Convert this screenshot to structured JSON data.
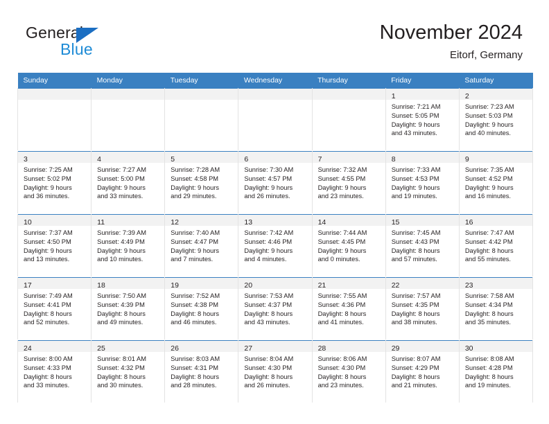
{
  "brand": {
    "name_dark": "General",
    "name_light": "Blue",
    "triangle_color": "#1b6ec2",
    "light_color": "#1e8bd6"
  },
  "header": {
    "title": "November 2024",
    "subtitle": "Eitorf, Germany",
    "header_bg": "#3a80c1",
    "daynum_bg": "#f2f2f2"
  },
  "weekdays": [
    "Sunday",
    "Monday",
    "Tuesday",
    "Wednesday",
    "Thursday",
    "Friday",
    "Saturday"
  ],
  "weeks": [
    [
      {
        "day": "",
        "lines": []
      },
      {
        "day": "",
        "lines": []
      },
      {
        "day": "",
        "lines": []
      },
      {
        "day": "",
        "lines": []
      },
      {
        "day": "",
        "lines": []
      },
      {
        "day": "1",
        "lines": [
          "Sunrise: 7:21 AM",
          "Sunset: 5:05 PM",
          "Daylight: 9 hours",
          "and 43 minutes."
        ]
      },
      {
        "day": "2",
        "lines": [
          "Sunrise: 7:23 AM",
          "Sunset: 5:03 PM",
          "Daylight: 9 hours",
          "and 40 minutes."
        ]
      }
    ],
    [
      {
        "day": "3",
        "lines": [
          "Sunrise: 7:25 AM",
          "Sunset: 5:02 PM",
          "Daylight: 9 hours",
          "and 36 minutes."
        ]
      },
      {
        "day": "4",
        "lines": [
          "Sunrise: 7:27 AM",
          "Sunset: 5:00 PM",
          "Daylight: 9 hours",
          "and 33 minutes."
        ]
      },
      {
        "day": "5",
        "lines": [
          "Sunrise: 7:28 AM",
          "Sunset: 4:58 PM",
          "Daylight: 9 hours",
          "and 29 minutes."
        ]
      },
      {
        "day": "6",
        "lines": [
          "Sunrise: 7:30 AM",
          "Sunset: 4:57 PM",
          "Daylight: 9 hours",
          "and 26 minutes."
        ]
      },
      {
        "day": "7",
        "lines": [
          "Sunrise: 7:32 AM",
          "Sunset: 4:55 PM",
          "Daylight: 9 hours",
          "and 23 minutes."
        ]
      },
      {
        "day": "8",
        "lines": [
          "Sunrise: 7:33 AM",
          "Sunset: 4:53 PM",
          "Daylight: 9 hours",
          "and 19 minutes."
        ]
      },
      {
        "day": "9",
        "lines": [
          "Sunrise: 7:35 AM",
          "Sunset: 4:52 PM",
          "Daylight: 9 hours",
          "and 16 minutes."
        ]
      }
    ],
    [
      {
        "day": "10",
        "lines": [
          "Sunrise: 7:37 AM",
          "Sunset: 4:50 PM",
          "Daylight: 9 hours",
          "and 13 minutes."
        ]
      },
      {
        "day": "11",
        "lines": [
          "Sunrise: 7:39 AM",
          "Sunset: 4:49 PM",
          "Daylight: 9 hours",
          "and 10 minutes."
        ]
      },
      {
        "day": "12",
        "lines": [
          "Sunrise: 7:40 AM",
          "Sunset: 4:47 PM",
          "Daylight: 9 hours",
          "and 7 minutes."
        ]
      },
      {
        "day": "13",
        "lines": [
          "Sunrise: 7:42 AM",
          "Sunset: 4:46 PM",
          "Daylight: 9 hours",
          "and 4 minutes."
        ]
      },
      {
        "day": "14",
        "lines": [
          "Sunrise: 7:44 AM",
          "Sunset: 4:45 PM",
          "Daylight: 9 hours",
          "and 0 minutes."
        ]
      },
      {
        "day": "15",
        "lines": [
          "Sunrise: 7:45 AM",
          "Sunset: 4:43 PM",
          "Daylight: 8 hours",
          "and 57 minutes."
        ]
      },
      {
        "day": "16",
        "lines": [
          "Sunrise: 7:47 AM",
          "Sunset: 4:42 PM",
          "Daylight: 8 hours",
          "and 55 minutes."
        ]
      }
    ],
    [
      {
        "day": "17",
        "lines": [
          "Sunrise: 7:49 AM",
          "Sunset: 4:41 PM",
          "Daylight: 8 hours",
          "and 52 minutes."
        ]
      },
      {
        "day": "18",
        "lines": [
          "Sunrise: 7:50 AM",
          "Sunset: 4:39 PM",
          "Daylight: 8 hours",
          "and 49 minutes."
        ]
      },
      {
        "day": "19",
        "lines": [
          "Sunrise: 7:52 AM",
          "Sunset: 4:38 PM",
          "Daylight: 8 hours",
          "and 46 minutes."
        ]
      },
      {
        "day": "20",
        "lines": [
          "Sunrise: 7:53 AM",
          "Sunset: 4:37 PM",
          "Daylight: 8 hours",
          "and 43 minutes."
        ]
      },
      {
        "day": "21",
        "lines": [
          "Sunrise: 7:55 AM",
          "Sunset: 4:36 PM",
          "Daylight: 8 hours",
          "and 41 minutes."
        ]
      },
      {
        "day": "22",
        "lines": [
          "Sunrise: 7:57 AM",
          "Sunset: 4:35 PM",
          "Daylight: 8 hours",
          "and 38 minutes."
        ]
      },
      {
        "day": "23",
        "lines": [
          "Sunrise: 7:58 AM",
          "Sunset: 4:34 PM",
          "Daylight: 8 hours",
          "and 35 minutes."
        ]
      }
    ],
    [
      {
        "day": "24",
        "lines": [
          "Sunrise: 8:00 AM",
          "Sunset: 4:33 PM",
          "Daylight: 8 hours",
          "and 33 minutes."
        ]
      },
      {
        "day": "25",
        "lines": [
          "Sunrise: 8:01 AM",
          "Sunset: 4:32 PM",
          "Daylight: 8 hours",
          "and 30 minutes."
        ]
      },
      {
        "day": "26",
        "lines": [
          "Sunrise: 8:03 AM",
          "Sunset: 4:31 PM",
          "Daylight: 8 hours",
          "and 28 minutes."
        ]
      },
      {
        "day": "27",
        "lines": [
          "Sunrise: 8:04 AM",
          "Sunset: 4:30 PM",
          "Daylight: 8 hours",
          "and 26 minutes."
        ]
      },
      {
        "day": "28",
        "lines": [
          "Sunrise: 8:06 AM",
          "Sunset: 4:30 PM",
          "Daylight: 8 hours",
          "and 23 minutes."
        ]
      },
      {
        "day": "29",
        "lines": [
          "Sunrise: 8:07 AM",
          "Sunset: 4:29 PM",
          "Daylight: 8 hours",
          "and 21 minutes."
        ]
      },
      {
        "day": "30",
        "lines": [
          "Sunrise: 8:08 AM",
          "Sunset: 4:28 PM",
          "Daylight: 8 hours",
          "and 19 minutes."
        ]
      }
    ]
  ]
}
